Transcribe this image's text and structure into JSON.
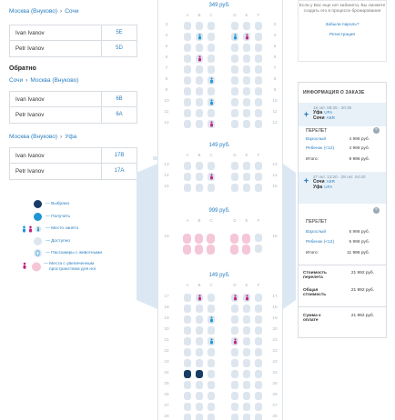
{
  "left": {
    "outbound_route": {
      "from": "Москва (Внуково)",
      "to": "Сочи",
      "sep": "›"
    },
    "outbound_passengers": [
      {
        "name": "Ivan Ivanov",
        "seat": "5E"
      },
      {
        "name": "Petr Ivanov",
        "seat": "5D"
      }
    ],
    "return_title": "Обратно",
    "return_route": {
      "from": "Сочи",
      "to": "Москва (Внуково)",
      "sep": "›"
    },
    "return_passengers": [
      {
        "name": "Ivan Ivanov",
        "seat": "6B"
      },
      {
        "name": "Petr Ivanov",
        "seat": "6A"
      }
    ],
    "third_route": {
      "from": "Москва (Внуково)",
      "to": "Уфа",
      "sep": "›"
    },
    "third_passengers": [
      {
        "name": "Ivan Ivanov",
        "seat": "17B"
      },
      {
        "name": "Petr Ivanov",
        "seat": "17A"
      }
    ],
    "legend": [
      {
        "icon": "selected-seat-icon",
        "label": "— Выбрано"
      },
      {
        "icon": "available-seat-icon",
        "label": "— Получить"
      },
      {
        "icon": "occupied-seat-icon",
        "label": "— Место занято"
      },
      {
        "icon": "free-seat-icon",
        "label": "— Доступно"
      },
      {
        "icon": "pet-seat-icon",
        "label": "— Пассажиры с животными"
      },
      {
        "icon": "extra-legroom-seat-icon",
        "label": "— Места с увеличенным",
        "label2": "пространством для ног"
      }
    ]
  },
  "plane": {
    "sections": [
      {
        "price": "349 руб."
      },
      {
        "price": "149 руб."
      },
      {
        "price": "999 руб."
      },
      {
        "price": "149 руб."
      }
    ],
    "column_letters": [
      "A",
      "B",
      "C",
      "",
      "D",
      "E",
      "F"
    ]
  },
  "login": {
    "text": "Если у Вас еще нет кабинета, Вы сможете создать его в процессе бронирования",
    "forgot": "Забыли пароль?",
    "register": "Регистрация"
  },
  "order": {
    "title": "ИНФОРМАЦИЯ О ЗАКАЗЕ",
    "flight1": {
      "time": "18 окт. 08:35 - 20:35",
      "from_city": "Уфа",
      "from_code": "UFA",
      "to_city": "Сочи",
      "to_code": "AER"
    },
    "fare1": {
      "title": "ПЕРЕЛЕТ",
      "adult_k": "Взрослый",
      "adult_v": "4 998 руб.",
      "child_k": "Ребенок (<12)",
      "child_v": "4 998 руб.",
      "total_k": "Итого:",
      "total_v": "9 996 руб."
    },
    "flight2": {
      "time": "27 окт. 13:20 - 28 окт. 04:40",
      "from_city": "Сочи",
      "from_code": "AER",
      "to_city": "Уфа",
      "to_code": "UFA"
    },
    "fare2": {
      "title": "ПЕРЕЛЕТ",
      "adult_k": "Взрослый",
      "adult_v": "5 998 руб.",
      "child_k": "Ребенок (<12)",
      "child_v": "5 998 руб.",
      "total_k": "Итого:",
      "total_v": "11 996 руб."
    },
    "cost_k": "Стоимость перелета",
    "cost_v": "21 992 руб.",
    "total_k": "Общая стоимость",
    "total_v": "21 992 руб.",
    "pay_k": "Сумма к оплате",
    "pay_v": "21 992 руб."
  },
  "colors": {
    "accent": "#2a7fc0",
    "selected": "#173c66",
    "available": "#1f95d4",
    "free": "#dde6ee",
    "legroom": "#f4c6d8",
    "pet": "#c0237f"
  }
}
